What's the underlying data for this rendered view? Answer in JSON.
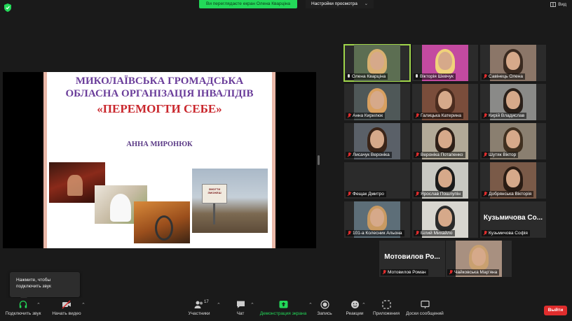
{
  "top": {
    "share_banner": "Ви переглядаєте екран Олена Кварціна",
    "view_options": "Настройки просмотра",
    "view_button": "Вид"
  },
  "slide": {
    "title_line1": "МИКОЛАЇВСЬКА ГРОМАДСЬКА",
    "title_line2": "ОБЛАСНА ОРГАНІЗАЦІЯ ІНВАЛІДІВ",
    "title_line3": "«ПЕРЕМОГТИ СЕБЕ»",
    "author": "АННА МИРОНЮК",
    "billboard_text": "ЗМОГТИ ЗМОЖЕШ"
  },
  "participants": [
    {
      "name": "Олена Кварціна",
      "muted": false,
      "active": true,
      "hair": "#d8b070",
      "bg": "#5c6e52"
    },
    {
      "name": "Вікторія Шевчук",
      "muted": false,
      "active": false,
      "hair": "#f0d27a",
      "bg": "#c34aa0"
    },
    {
      "name": "Савінець Олена",
      "muted": true,
      "active": false,
      "hair": "#3a2a20",
      "bg": "#8b7668"
    },
    {
      "name": "Анна Кирилюк",
      "muted": true,
      "active": false,
      "hair": "#d8a060",
      "bg": "#4f5858"
    },
    {
      "name": "Галицька Катерина",
      "muted": true,
      "active": false,
      "hair": "#4b2c1f",
      "bg": "#7a4d3b"
    },
    {
      "name": "Кирій Владислав",
      "muted": true,
      "active": false,
      "hair": "#2a201a",
      "bg": "#8a8a88"
    },
    {
      "name": "Лисачук Вероніка",
      "muted": true,
      "active": false,
      "hair": "#3a2418",
      "bg": "#5a6068"
    },
    {
      "name": "Вероніка Потапенко",
      "muted": true,
      "active": false,
      "hair": "#2e2018",
      "bg": "#b2aa98"
    },
    {
      "name": "Шутяк Віктор",
      "muted": true,
      "active": false,
      "hair": "#403020",
      "bg": "#8a7f70"
    },
    {
      "name": "Фещак Дмитро",
      "muted": true,
      "active": false,
      "hair": "",
      "bg": "#2b2b2b",
      "no_video": true
    },
    {
      "name": "Ярослав Пошлупін",
      "muted": true,
      "active": false,
      "hair": "#1a1a1a",
      "bg": "#c8c8c2"
    },
    {
      "name": "Добрянська Вікторія",
      "muted": true,
      "active": false,
      "hair": "#2a1c14",
      "bg": "#7a5a48"
    },
    {
      "name": "101-а Колесник Альона",
      "muted": true,
      "active": false,
      "hair": "#c99a62",
      "bg": "#5d6e78"
    },
    {
      "name": "Білий Михайло",
      "muted": true,
      "active": false,
      "hair": "#2a2a2a",
      "bg": "#d8d6d0"
    },
    {
      "name": "Кузьмичова Софія",
      "muted": true,
      "active": false,
      "hair": "",
      "bg": "#2b2b2b",
      "no_video": true,
      "big_name": "Кузьмичова Со..."
    },
    {
      "name": "Мотовилов Роман",
      "muted": true,
      "active": false,
      "hair": "",
      "bg": "#2b2b2b",
      "no_video": true,
      "big_name": "Мотовилов Ро..."
    },
    {
      "name": "Чайковська Мар'яна",
      "muted": true,
      "active": false,
      "hair": "#c9a070",
      "bg": "#a89080"
    }
  ],
  "tooltip": {
    "line1": "Нажмите, чтобы",
    "line2": "подключить звук"
  },
  "toolbar": {
    "join_audio": "Подключить звук",
    "start_video": "Начать видео",
    "participants": "Участники",
    "participants_count": "17",
    "chat": "Чат",
    "share_screen": "Демонстрация экрана",
    "record": "Запись",
    "reactions": "Реакции",
    "apps": "Приложения",
    "whiteboards": "Доски сообщений",
    "leave": "Выйти"
  },
  "colors": {
    "share_green": "#23d959",
    "leave_red": "#e02d2d",
    "active_speaker": "#9fd44a",
    "slide_purple": "#6a3d9a",
    "slide_red": "#c9262c"
  }
}
